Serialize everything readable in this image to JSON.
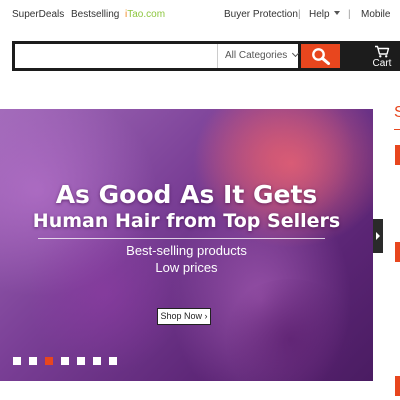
{
  "topnav": {
    "superdeals": "SuperDeals",
    "bestselling": "Bestselling",
    "itao_i": "i",
    "itao_rest": "Tao.com",
    "buyer_protection": "Buyer Protection",
    "sep": "|",
    "help": "Help",
    "mobile": "Mobile"
  },
  "search": {
    "value": "",
    "placeholder": "",
    "category": "All Categories",
    "button_icon": "search-icon"
  },
  "cart": {
    "label": "Cart",
    "icon": "cart-icon"
  },
  "banner": {
    "headline1": "As Good As It Gets",
    "headline2": "Human Hair from Top Sellers",
    "sub1": "Best-selling products",
    "sub2": "Low prices",
    "cta": "Shop Now ›",
    "slide_count": 7,
    "active_slide": 3,
    "next_icon": "chevron-right-icon"
  },
  "side": {
    "letter": "S"
  },
  "colors": {
    "accent": "#e8461e",
    "search_bar": "#1c1c1c",
    "itao_i": "#f08a24",
    "itao_rest": "#8cc63e"
  }
}
